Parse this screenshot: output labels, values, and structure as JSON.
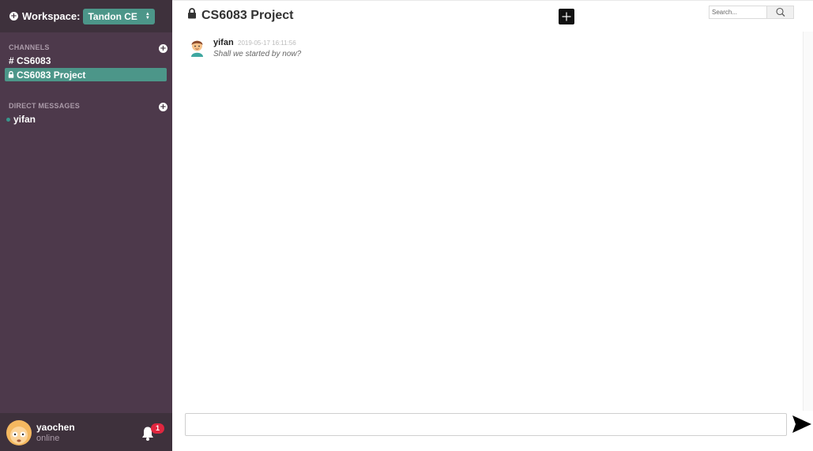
{
  "workspace": {
    "label": "Workspace:",
    "selected": "Tandon CE"
  },
  "sidebar": {
    "channels_title": "CHANNELS",
    "channels": [
      {
        "prefix": "#",
        "name": "CS6083",
        "private": false,
        "active": false
      },
      {
        "prefix": "",
        "name": "CS6083 Project",
        "private": true,
        "active": true
      }
    ],
    "dm_title": "DIRECT MESSAGES",
    "direct_messages": [
      {
        "name": "yifan",
        "status": "online"
      }
    ]
  },
  "current_user": {
    "name": "yaochen",
    "status": "online",
    "notifications": "1"
  },
  "channel": {
    "title": "CS6083 Project"
  },
  "search": {
    "placeholder": "Search..."
  },
  "messages": [
    {
      "author": "yifan",
      "timestamp": "2019-05-17 16:11:56",
      "text": "Shall we started by now?"
    }
  ],
  "composer": {
    "value": ""
  },
  "colors": {
    "sidebar": "#4d394b",
    "sidebar_dark": "#3e313c",
    "accent": "#4c9689",
    "badge": "#e0263f"
  },
  "icons": [
    "plus-circle-icon",
    "lock-icon",
    "bell-icon",
    "search-icon",
    "plus-icon",
    "send-icon"
  ]
}
